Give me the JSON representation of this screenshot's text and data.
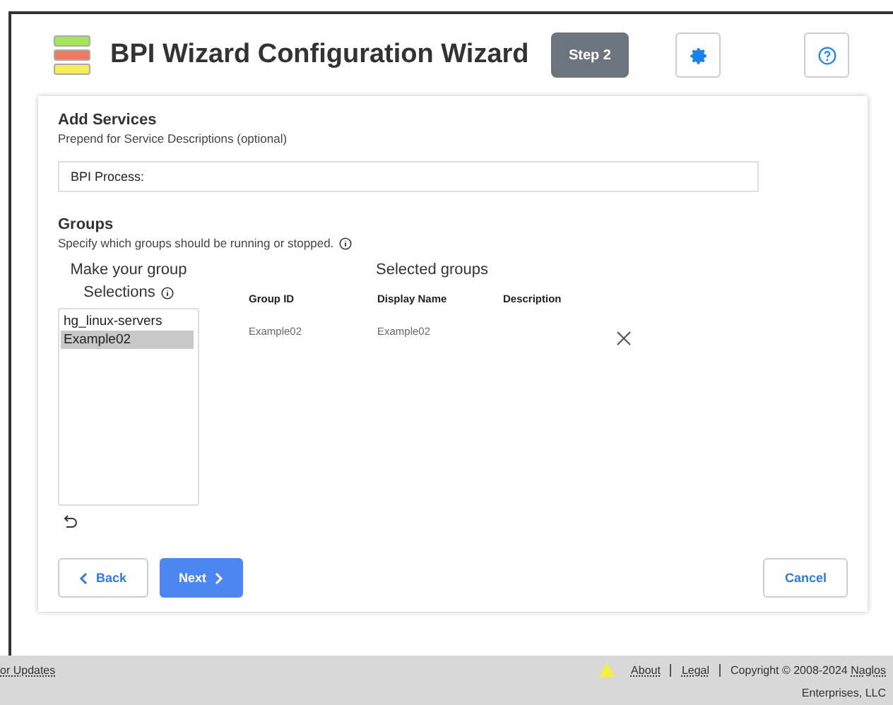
{
  "header": {
    "title": "BPI Wizard Configuration Wizard",
    "step": "Step 2"
  },
  "services": {
    "heading": "Add Services",
    "hint": "Prepend for Service Descriptions (optional)",
    "value": "BPI Process:"
  },
  "groups": {
    "heading": "Groups",
    "hint": "Specify which groups should be running or stopped.",
    "picker_title_1": "Make your group",
    "picker_title_2": "Selections",
    "options": [
      {
        "label": "hg_linux-servers",
        "selected": false
      },
      {
        "label": "Example02",
        "selected": true
      }
    ],
    "selected_title": "Selected groups",
    "columns": [
      "Group ID",
      "Display Name",
      "Description"
    ],
    "rows": [
      {
        "group_id": "Example02",
        "display_name": "Example02"
      }
    ]
  },
  "buttons": {
    "back": "Back",
    "next": "Next",
    "cancel": "Cancel"
  },
  "footer": {
    "left": "or Updates",
    "about": "About",
    "legal": "Legal",
    "copyright": "Copyright © 2008-2024",
    "naglos": "Naglos",
    "line2": "Enterprises, LLC"
  }
}
